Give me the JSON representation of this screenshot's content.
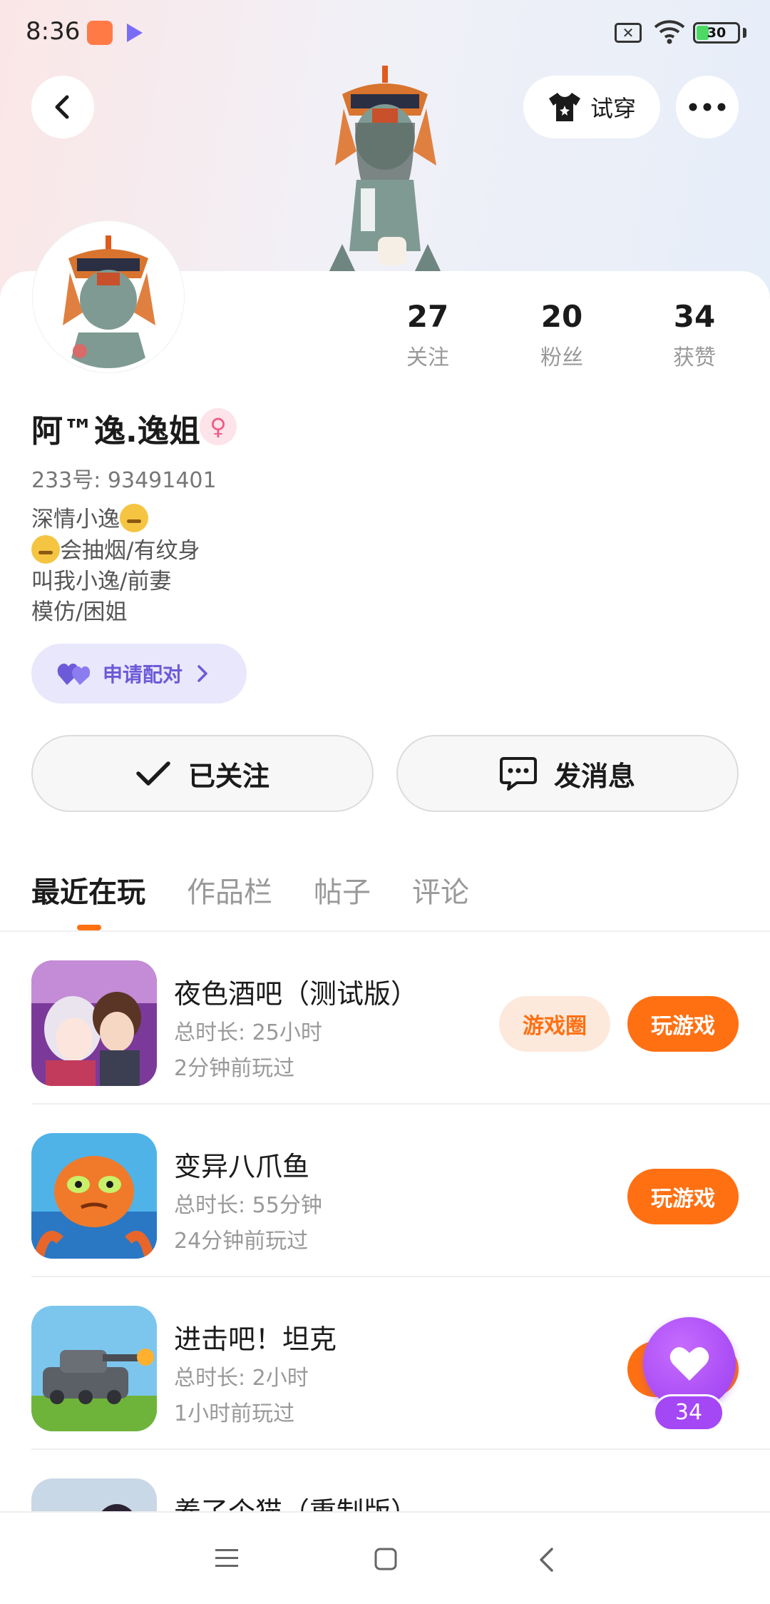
{
  "status_bar": {
    "time": "8:36",
    "battery": "30",
    "battery_level": 0.3
  },
  "header": {
    "tryon_label": "试穿"
  },
  "profile": {
    "nickname": "阿™逸.逸姐",
    "gender_symbol": "♀",
    "uid": "233号: 93491401",
    "bio_lines": [
      "深情小逸",
      "会抽烟/有纹身",
      "叫我小逸/前妻",
      "模仿/困姐"
    ],
    "pair_label": "申请配对"
  },
  "stats": [
    {
      "value": "27",
      "label": "关注"
    },
    {
      "value": "20",
      "label": "粉丝"
    },
    {
      "value": "34",
      "label": "获赞"
    }
  ],
  "actions": {
    "follow_label": "已关注",
    "message_label": "发消息"
  },
  "tabs": [
    {
      "label": "最近在玩",
      "active": true
    },
    {
      "label": "作品栏",
      "active": false
    },
    {
      "label": "帖子",
      "active": false
    },
    {
      "label": "评论",
      "active": false
    }
  ],
  "games": [
    {
      "title": "夜色酒吧（测试版）",
      "duration": "总时长: 25小时",
      "last_played": "2分钟前玩过",
      "circle_label": "游戏圈",
      "play_label": "玩游戏"
    },
    {
      "title": "变异八爪鱼",
      "duration": "总时长: 55分钟",
      "last_played": "24分钟前玩过",
      "play_label": "玩游戏"
    },
    {
      "title": "进击吧！坦克",
      "duration": "总时长: 2小时",
      "last_played": "1小时前玩过",
      "play_label": "玩游戏"
    },
    {
      "title": "养了个猫（重制版）"
    }
  ],
  "like_fab": {
    "count": "34"
  },
  "colors": {
    "accent_orange": "#ff7013",
    "accent_purple": "#a447f5",
    "pair_purple": "#6c5ad8"
  }
}
